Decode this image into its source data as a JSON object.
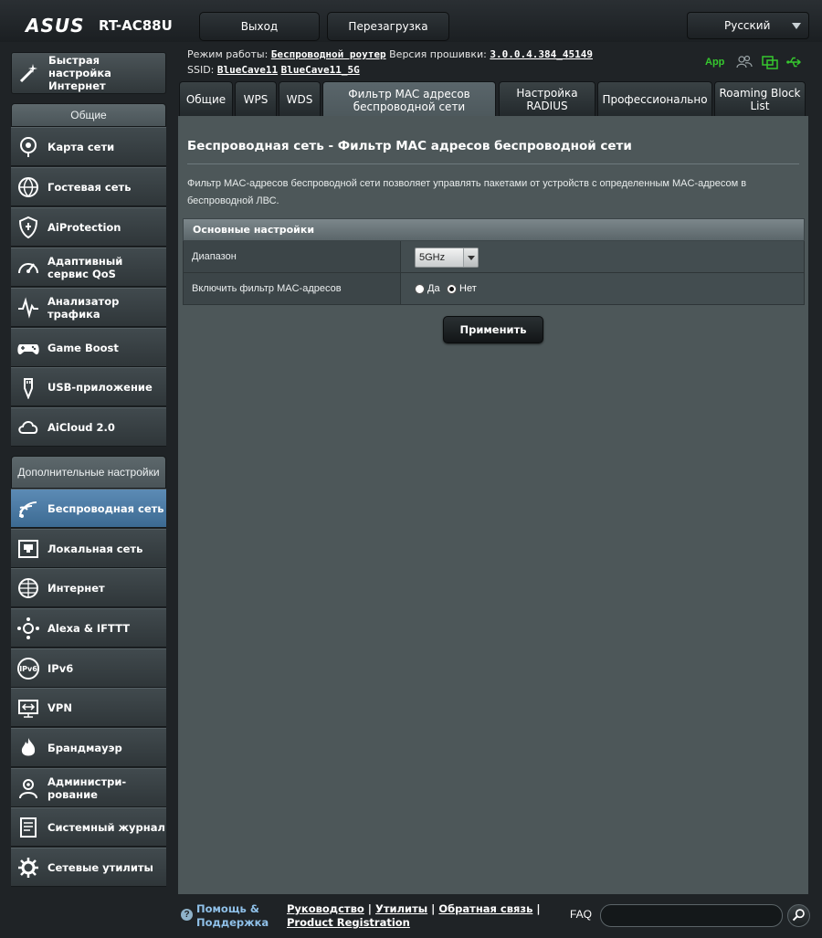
{
  "header": {
    "logo": "ASUS",
    "model": "RT-AC88U",
    "logout_label": "Выход",
    "reboot_label": "Перезагрузка",
    "language": "Русский"
  },
  "status": {
    "mode_label": "Режим работы:",
    "mode_value": "Беспроводной роутер",
    "firmware_label": "Версия прошивки:",
    "firmware_value": "3.0.0.4.384_45149",
    "ssid_label": "SSID:",
    "ssid_1": "BlueCave11",
    "ssid_2": "BlueCave11_5G",
    "app_label": "App",
    "colors": {
      "app": "#36c82e",
      "usb": "#36c82e"
    }
  },
  "sidebar": {
    "quick_setup": "Быстрая настройка Интернет",
    "general_header": "Общие",
    "general_items": [
      {
        "label": "Карта сети",
        "icon": "network-map-icon"
      },
      {
        "label": "Гостевая сеть",
        "icon": "guest-network-icon"
      },
      {
        "label": "AiProtection",
        "icon": "shield-icon"
      },
      {
        "label": "Адаптивный сервис QoS",
        "icon": "gauge-icon"
      },
      {
        "label": "Анализатор трафика",
        "icon": "traffic-analyzer-icon"
      },
      {
        "label": "Game Boost",
        "icon": "gamepad-icon"
      },
      {
        "label": "USB-приложение",
        "icon": "usb-icon"
      },
      {
        "label": "AiCloud 2.0",
        "icon": "cloud-icon"
      }
    ],
    "advanced_header": "Дополнительные настройки",
    "advanced_items": [
      {
        "label": "Беспроводная сеть",
        "icon": "wifi-icon"
      },
      {
        "label": "Локальная сеть",
        "icon": "lan-icon"
      },
      {
        "label": "Интернет",
        "icon": "globe-icon"
      },
      {
        "label": "Alexa & IFTTT",
        "icon": "alexa-icon"
      },
      {
        "label": "IPv6",
        "icon": "ipv6-icon"
      },
      {
        "label": "VPN",
        "icon": "vpn-icon"
      },
      {
        "label": "Брандмауэр",
        "icon": "firewall-icon"
      },
      {
        "label": "Администри-рование",
        "icon": "admin-icon"
      },
      {
        "label": "Системный журнал",
        "icon": "syslog-icon"
      },
      {
        "label": "Сетевые утилиты",
        "icon": "tools-icon"
      }
    ],
    "active_item": "Беспроводная сеть"
  },
  "tabs": [
    {
      "label": "Общие"
    },
    {
      "label": "WPS"
    },
    {
      "label": "WDS"
    },
    {
      "label": "Фильтр MAC адресов беспроводной сети"
    },
    {
      "label": "Настройка RADIUS"
    },
    {
      "label": "Профессионально"
    },
    {
      "label": "Roaming Block List"
    }
  ],
  "main": {
    "title": "Беспроводная сеть - Фильтр MAC адресов беспроводной сети",
    "description": "Фильтр MAC-адресов беспроводной сети позволяет управлять пакетами от устройств с определенным MAC-адресом в беспроводной ЛВС.",
    "section_title": "Основные настройки",
    "band_label": "Диапазон",
    "band_value": "5GHz",
    "enable_label": "Включить фильтр MAC-адресов",
    "yes_label": "Да",
    "no_label": "Нет",
    "enable_value": "Нет",
    "apply_label": "Применить"
  },
  "footer": {
    "help_label": "Помощь & Поддержка",
    "link_manual": "Руководство",
    "link_utilities": "Утилиты",
    "link_feedback": "Обратная связь",
    "link_registration": "Product Registration",
    "separator": "|",
    "faq_label": "FAQ"
  }
}
